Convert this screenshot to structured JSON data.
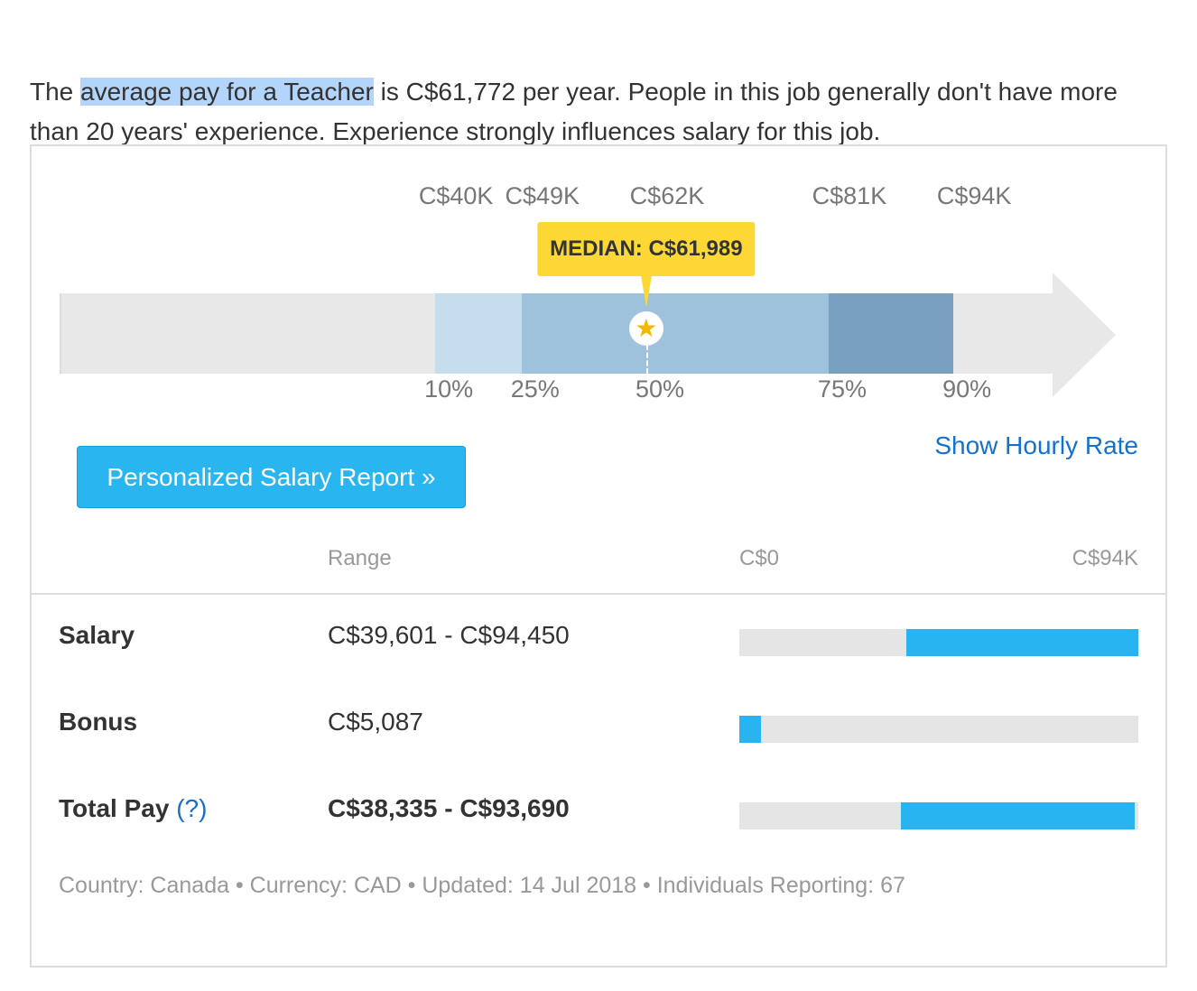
{
  "intro": {
    "highlight": "average pay for a Teacher",
    "pre": "The ",
    "post": " is C$61,772 per year. People in this job generally don't have more than 20 years' experience. Experience strongly influences salary for this job."
  },
  "chart_data": {
    "type": "bar",
    "percentiles": [
      {
        "label": "10%",
        "value_label": "C$40K",
        "value": 40
      },
      {
        "label": "25%",
        "value_label": "C$49K",
        "value": 49
      },
      {
        "label": "50%",
        "value_label": "C$62K",
        "value": 62
      },
      {
        "label": "75%",
        "value_label": "C$81K",
        "value": 81
      },
      {
        "label": "90%",
        "value_label": "C$94K",
        "value": 94
      }
    ],
    "median_label": "MEDIAN: C$61,989",
    "colors": {
      "p10_25": "#c5dded",
      "p25_75": "#9fc2dc",
      "p75_90": "#799fc1",
      "track": "#e8e8e8",
      "median": "#fdd835",
      "range_fill": "#27b4f1"
    },
    "range_axis": {
      "min_label": "C$0",
      "max_label": "C$94K",
      "min": 0,
      "max": 94450
    },
    "rows": [
      {
        "label": "Salary",
        "value": "C$39,601 - C$94,450",
        "low": 39601,
        "high": 94450
      },
      {
        "label": "Bonus",
        "value": "C$5,087",
        "low": 0,
        "high": 5087
      },
      {
        "label": "Total Pay",
        "help": "?",
        "value": "C$38,335 - C$93,690",
        "low": 38335,
        "high": 93690
      }
    ]
  },
  "buttons": {
    "report": "Personalized Salary Report »",
    "hourly": "Show Hourly Rate"
  },
  "table": {
    "range_header": "Range"
  },
  "footer": "Country: Canada  •  Currency: CAD  •  Updated: 14 Jul 2018  •  Individuals Reporting: 67"
}
